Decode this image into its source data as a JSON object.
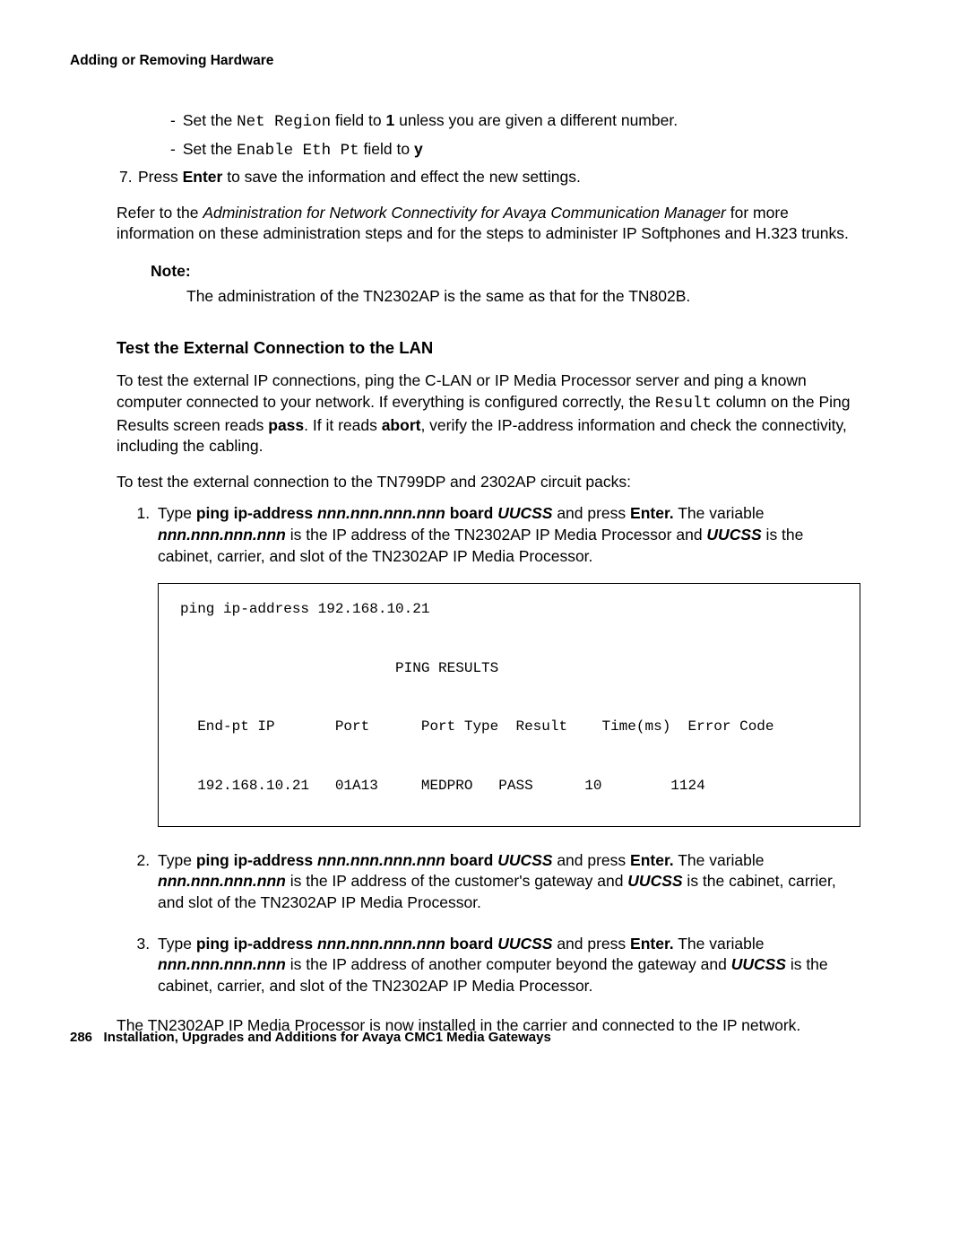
{
  "header": "Adding or Removing Hardware",
  "sub_bullets": {
    "a_pre": "Set the ",
    "a_field": "Net Region",
    "a_mid": " field to ",
    "a_val": "1",
    "a_post": " unless you are given a different number.",
    "b_pre": "Set the ",
    "b_field": "Enable Eth Pt",
    "b_mid": "  field to ",
    "b_val": "y"
  },
  "step7": {
    "num": "7.",
    "pre": "Press ",
    "enter": "Enter",
    "post": " to save the information and effect the new settings."
  },
  "refer": {
    "pre": "Refer to the ",
    "doc": "Administration for Network Connectivity for Avaya Communication Manager",
    "post": " for more information on these administration steps and for the steps to administer IP Softphones and H.323 trunks."
  },
  "note": {
    "label": "Note:",
    "text": "The administration of the TN2302AP is the same as that for the TN802B."
  },
  "section_title": "Test the External Connection to the LAN",
  "test_para1": {
    "pre": "To test the external IP connections, ping the C-LAN or IP Media Processor server and ping a known computer connected to your network. If everything is configured correctly, the ",
    "result_word": "Result",
    "mid1": " column on the Ping Results screen reads ",
    "pass": "pass",
    "mid2": ". If it reads ",
    "abort": "abort",
    "post": ", verify the IP-address information and check the connectivity, including the cabling."
  },
  "test_para2": "To test the external connection to the TN799DP and 2302AP circuit packs:",
  "steps": {
    "s1": {
      "pre": "Type ",
      "cmd1": "ping ip-address ",
      "nnn": "nnn.nnn.nnn.nnn",
      "cmd2": " board ",
      "uucss": "UUCSS",
      "mid1": " and press ",
      "enter": "Enter.",
      "mid2": " The variable ",
      "post1": " is the IP address of the TN2302AP IP Media Processor and ",
      "post2": " is the cabinet, carrier, and slot of the TN2302AP IP Media Processor."
    },
    "s2": {
      "pre": "Type ",
      "cmd1": "ping ip-address ",
      "nnn": "nnn.nnn.nnn.nnn",
      "cmd2": " board ",
      "uucss": "UUCSS",
      "mid1": " and press ",
      "enter": "Enter.",
      "mid2": " The variable ",
      "post1": " is the IP address of the customer's gateway and ",
      "post2": " is the cabinet, carrier, and slot of the TN2302AP IP Media Processor."
    },
    "s3": {
      "pre": "Type ",
      "cmd1": "ping ip-address ",
      "nnn": "nnn.nnn.nnn.nnn",
      "cmd2": " board ",
      "uucss": "UUCSS",
      "mid1": " and press ",
      "enter": "Enter.",
      "mid2": " The variable ",
      "post1": " is the IP address of another computer beyond the gateway and ",
      "post2": " is the cabinet, carrier, and slot of the TN2302AP IP Media Processor."
    }
  },
  "codebox": "ping ip-address 192.168.10.21\n\n                         PING RESULTS\n\n  End-pt IP       Port      Port Type  Result    Time(ms)  Error Code\n\n  192.168.10.21   01A13     MEDPRO   PASS      10        1124",
  "final_para": "The TN2302AP IP Media Processor is now installed in the carrier and connected to the IP network.",
  "footer": {
    "page": "286",
    "title": "Installation, Upgrades and Additions for Avaya CMC1 Media Gateways"
  }
}
